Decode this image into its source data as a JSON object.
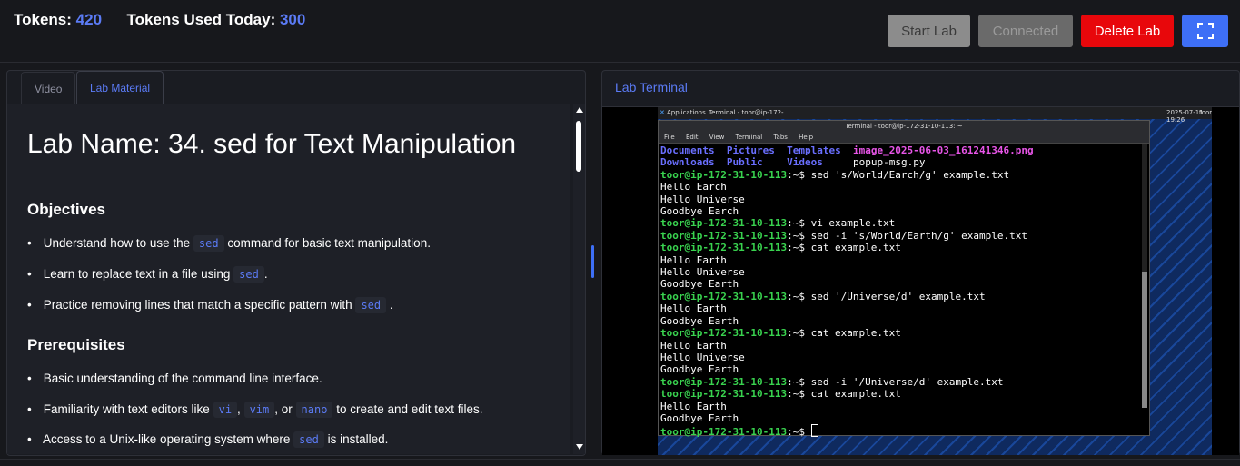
{
  "header": {
    "tokens_label": "Tokens:",
    "tokens_value": "420",
    "tokens_used_label": "Tokens Used Today:",
    "tokens_used_value": "300",
    "start_label": "Start Lab",
    "connected_label": "Connected",
    "delete_label": "Delete Lab",
    "fullscreen_icon": "fullscreen-icon"
  },
  "left_panel": {
    "tabs": [
      "Video",
      "Lab Material"
    ],
    "active_tab": "Lab Material",
    "title": "Lab Name: 34. sed for Text Manipulation",
    "objectives_heading": "Objectives",
    "objectives": [
      {
        "before": "Understand how to use the",
        "code": "sed",
        "after": "command for basic text manipulation."
      },
      {
        "before": "Learn to replace text in a file using",
        "code": "sed",
        "after": "."
      },
      {
        "before": "Practice removing lines that match a specific pattern with",
        "code": "sed",
        "after": "."
      }
    ],
    "prereq_heading": "Prerequisites",
    "prereq_1": "Basic understanding of the command line interface.",
    "prereq_2": {
      "before": "Familiarity with text editors like",
      "code1": "vi",
      "sep1": ",",
      "code2": "vim",
      "sep2": ", or",
      "code3": "nano",
      "after": "to create and edit text files."
    },
    "prereq_3": {
      "before": "Access to a Unix-like operating system where",
      "code": "sed",
      "after": "is installed."
    }
  },
  "right_panel": {
    "title": "Lab Terminal",
    "desktop_bar": {
      "applications": "Applications",
      "task": "Terminal - toor@ip-172-...",
      "clock": "2025-07-11 19:26",
      "user": "toor"
    },
    "window_title": "Terminal - toor@ip-172-31-10-113: ~",
    "menu": [
      "File",
      "Edit",
      "View",
      "Terminal",
      "Tabs",
      "Help"
    ],
    "ls_row1": {
      "d1": "Documents",
      "d2": "Pictures",
      "d3": "Templates",
      "img": "image_2025-06-03_161241346.png"
    },
    "ls_row2": {
      "d1": "Downloads",
      "d2": "Public",
      "d3": "Videos",
      "file": "popup-msg.py"
    },
    "prompt": "toor@ip-172-31-10-113",
    "lines": [
      {
        "cmd": "sed 's/World/Earch/g' example.txt"
      },
      {
        "out": "Hello Earch"
      },
      {
        "out": "Hello Universe"
      },
      {
        "out": "Goodbye Earch"
      },
      {
        "cmd": "vi example.txt"
      },
      {
        "cmd": "sed -i 's/World/Earth/g' example.txt"
      },
      {
        "cmd": "cat example.txt"
      },
      {
        "out": "Hello Earth"
      },
      {
        "out": "Hello Universe"
      },
      {
        "out": "Goodbye Earth"
      },
      {
        "cmd": "sed '/Universe/d' example.txt"
      },
      {
        "out": "Hello Earth"
      },
      {
        "out": "Goodbye Earth"
      },
      {
        "cmd": "cat example.txt"
      },
      {
        "out": "Hello Earth"
      },
      {
        "out": "Hello Universe"
      },
      {
        "out": "Goodbye Earth"
      },
      {
        "cmd": "sed -i '/Universe/d' example.txt"
      },
      {
        "cmd": "cat example.txt"
      },
      {
        "out": "Hello Earth"
      },
      {
        "out": "Goodbye Earth"
      },
      {
        "cmd": ""
      }
    ]
  },
  "colors": {
    "accent": "#5b7bf5",
    "delete": "#e8070b",
    "fullscreen": "#3e6ff6"
  }
}
